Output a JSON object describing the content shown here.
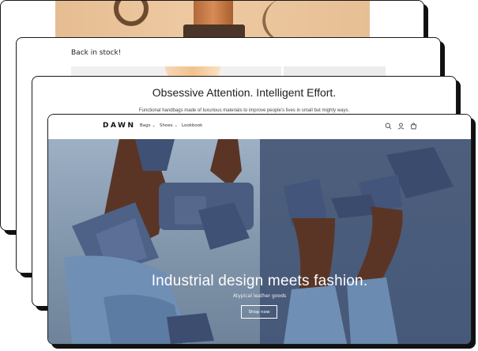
{
  "cards": {
    "card2": {
      "text": "Back in stock!"
    },
    "card3": {
      "title": "Obsessive Attention. Intelligent Effort.",
      "subtitle": "Functional handbags made of luxurious materials to improve people's lives in small but mighty ways."
    }
  },
  "store": {
    "logo": "DAWN",
    "nav": [
      {
        "label": "Bags",
        "has_dropdown": true
      },
      {
        "label": "Shoes",
        "has_dropdown": true
      },
      {
        "label": "Lookbook",
        "has_dropdown": false
      }
    ],
    "chevron": "⌄",
    "icons": [
      "search-icon",
      "account-icon",
      "cart-icon"
    ],
    "hero": {
      "title": "Industrial design meets fashion.",
      "subtitle": "Atypical leather goods",
      "button": "Shop now"
    }
  },
  "colors": {
    "hero_left": "#8fa2b7",
    "hero_right": "#4b5d7a",
    "product_blue": "#4a5c80",
    "skin": "#5a3526",
    "denim": "#6f8fb5",
    "tan_backdrop": "#eac49c"
  }
}
